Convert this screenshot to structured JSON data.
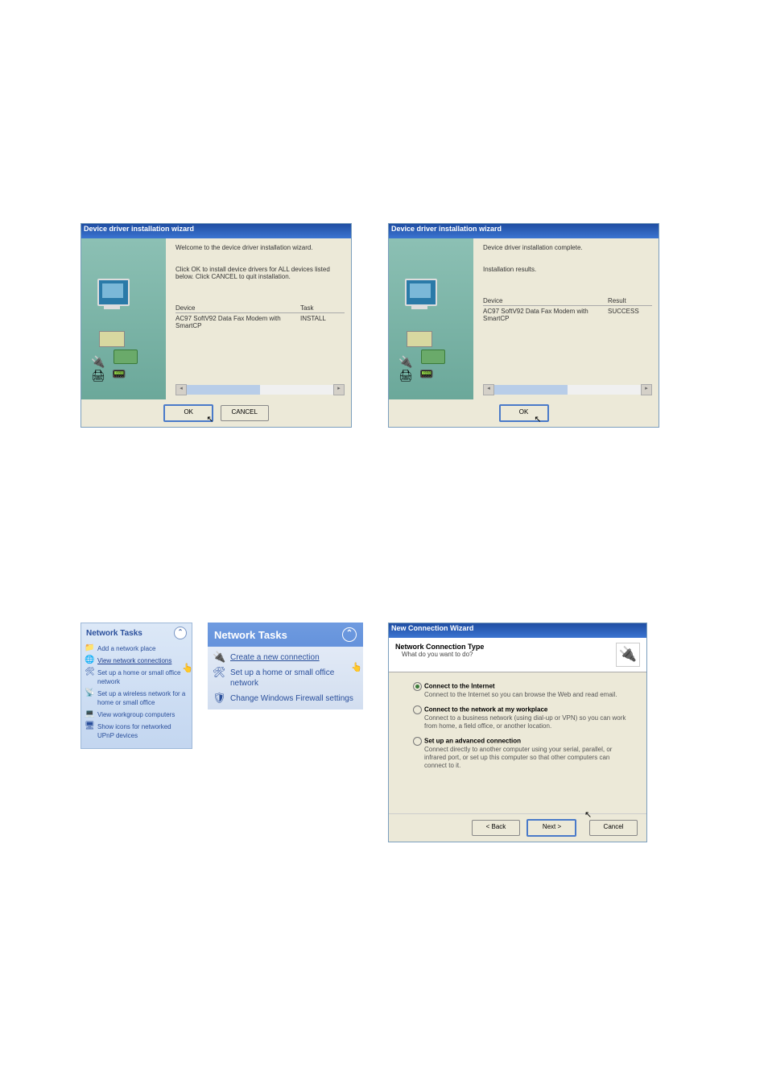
{
  "wiz1": {
    "title": "Device driver installation wizard",
    "welcome": "Welcome to the device driver installation wizard.",
    "instr": "Click OK to install device drivers for ALL devices listed below. Click CANCEL to quit installation.",
    "th_device": "Device",
    "th_task": "Task",
    "row_device": "AC97 SoftV92 Data Fax Modem with SmartCP",
    "row_task": "INSTALL",
    "btn_ok": "OK",
    "btn_cancel": "CANCEL"
  },
  "wiz2": {
    "title": "Device driver installation wizard",
    "complete": "Device driver installation complete.",
    "results": "Installation results.",
    "th_device": "Device",
    "th_result": "Result",
    "row_device": "AC97 SoftV92 Data Fax Modem with SmartCP",
    "row_result": "SUCCESS",
    "btn_ok": "OK"
  },
  "tasks1": {
    "header": "Network Tasks",
    "items": [
      {
        "icon": "📁",
        "label": "Add a network place"
      },
      {
        "icon": "🌐",
        "label": "View network connections"
      },
      {
        "icon": "🛠",
        "label": "Set up a home or small office network"
      },
      {
        "icon": "📡",
        "label": "Set up a wireless network for a home or small office"
      },
      {
        "icon": "💻",
        "label": "View workgroup computers"
      },
      {
        "icon": "🖥",
        "label": "Show icons for networked UPnP devices"
      }
    ]
  },
  "tasks2": {
    "header": "Network Tasks",
    "items": [
      {
        "icon": "🔌",
        "label": "Create a new connection"
      },
      {
        "icon": "🛠",
        "label": "Set up a home or small office network"
      },
      {
        "icon": "🛡",
        "label": "Change Windows Firewall settings"
      }
    ]
  },
  "conn": {
    "title": "New Connection Wizard",
    "h": "Network Connection Type",
    "s": "What do you want to do?",
    "opts": [
      {
        "t": "Connect to the Internet",
        "d": "Connect to the Internet so you can browse the Web and read email."
      },
      {
        "t": "Connect to the network at my workplace",
        "d": "Connect to a business network (using dial-up or VPN) so you can work from home, a field office, or another location."
      },
      {
        "t": "Set up an advanced connection",
        "d": "Connect directly to another computer using your serial, parallel, or infrared port, or set up this computer so that other computers can connect to it."
      }
    ],
    "back": "< Back",
    "next": "Next >",
    "cancel": "Cancel"
  }
}
